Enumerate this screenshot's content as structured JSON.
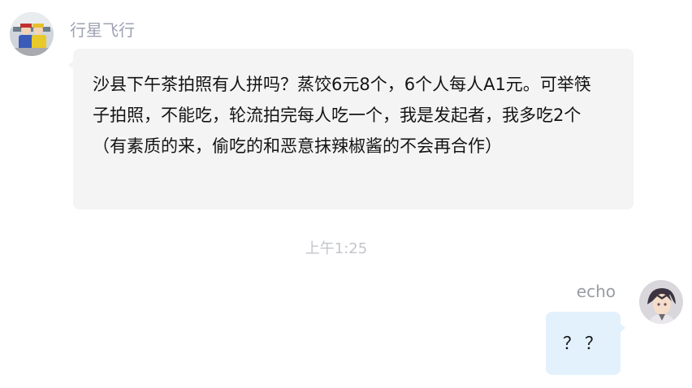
{
  "messages": [
    {
      "sender": "行星飞行",
      "text": "沙县下午茶拍照有人拼吗？蒸饺6元8个，6个人每人A1元。可举筷子拍照，不能吃，轮流拍完每人吃一个，我是发起者，我多吃2个（有素质的来，偷吃的和恶意抹辣椒酱的不会再合作）",
      "side": "left"
    },
    {
      "sender": "echo",
      "text": "？？",
      "side": "right"
    }
  ],
  "timestamp": "上午1:25",
  "colors": {
    "incoming_bubble": "#f4f4f5",
    "outgoing_bubble": "#e2f1fc",
    "sender_name": "#9da2b3",
    "timestamp": "#c3c5cb"
  },
  "icons": {
    "left_avatar": "user-avatar-icon",
    "right_avatar": "user-avatar-icon"
  }
}
